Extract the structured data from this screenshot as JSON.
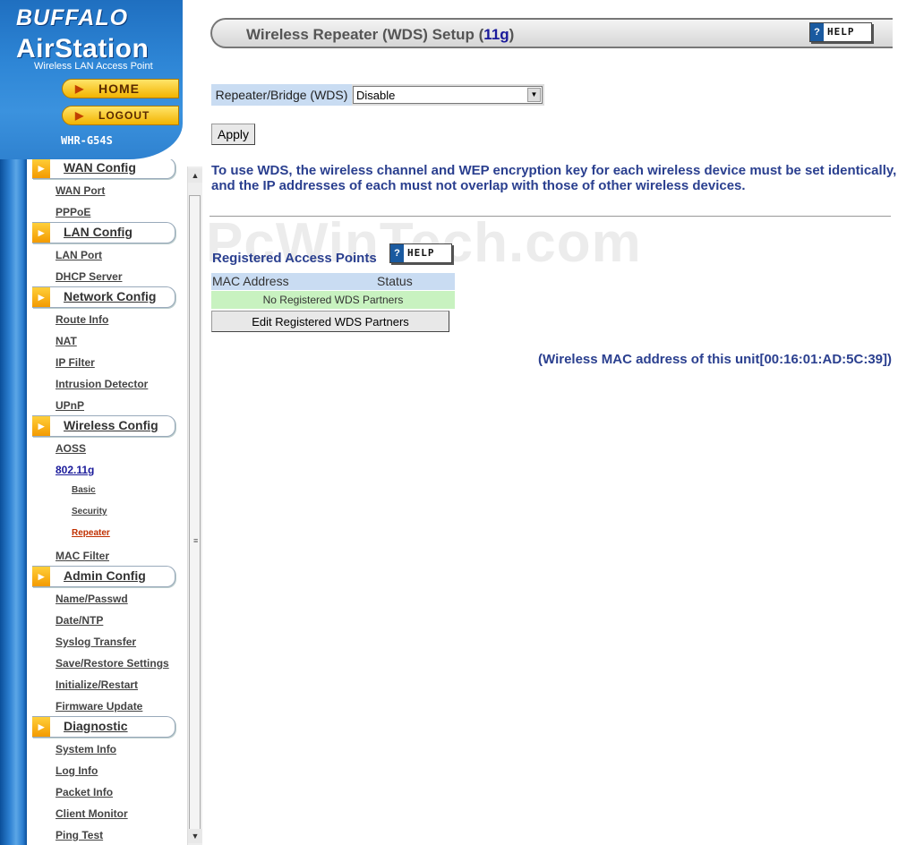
{
  "branding": {
    "brand": "BUFFALO",
    "product": "AirStation",
    "subtitle": "Wireless LAN Access Point",
    "model": "WHR-G54S",
    "home_label": "HOME",
    "logout_label": "LOGOUT"
  },
  "nav": {
    "sections": {
      "wan": "WAN Config",
      "lan": "LAN Config",
      "network": "Network Config",
      "wireless": "Wireless Config",
      "admin": "Admin Config",
      "diagnostic": "Diagnostic"
    },
    "items": {
      "wan_port": "WAN Port",
      "pppoe": "PPPoE",
      "lan_port": "LAN Port",
      "dhcp_server": "DHCP Server",
      "route_info": "Route Info",
      "nat": "NAT",
      "ip_filter": "IP Filter",
      "intrusion_detector": "Intrusion Detector",
      "upnp": "UPnP",
      "aoss": "AOSS",
      "dot11g": "802.11g",
      "basic": "Basic",
      "security": "Security",
      "repeater": "Repeater",
      "mac_filter": "MAC Filter",
      "name_passwd": "Name/Passwd",
      "date_ntp": "Date/NTP",
      "syslog": "Syslog Transfer",
      "save_restore": "Save/Restore Settings",
      "init_restart": "Initialize/Restart",
      "firmware": "Firmware Update",
      "system_info": "System Info",
      "log_info": "Log Info",
      "packet_info": "Packet Info",
      "client_monitor": "Client Monitor",
      "ping_test": "Ping Test"
    }
  },
  "main": {
    "title_prefix": "Wireless Repeater (WDS) Setup (",
    "title_band": "11g",
    "title_suffix": ")",
    "help_label": "HELP",
    "wds_label": "Repeater/Bridge (WDS)",
    "wds_value": "Disable",
    "apply_label": "Apply",
    "note": "To use WDS, the wireless channel and WEP encryption key for each wireless device must be set identically, and the IP addresses of each must not overlap with those of other wireless devices.",
    "watermark": "PcWinTech.com",
    "registered_title": "Registered Access Points",
    "col_mac": "MAC Address",
    "col_status": "Status",
    "empty_row": "No Registered WDS Partners",
    "edit_label": "Edit Registered WDS Partners",
    "mac_line": "(Wireless MAC address of this unit[00:16:01:AD:5C:39])"
  },
  "colors": {
    "accent_blue": "#2a3f8f",
    "header_blue": "#c9dcf2",
    "row_green": "#c8f2c0",
    "nav_orange": "#f39a00"
  }
}
